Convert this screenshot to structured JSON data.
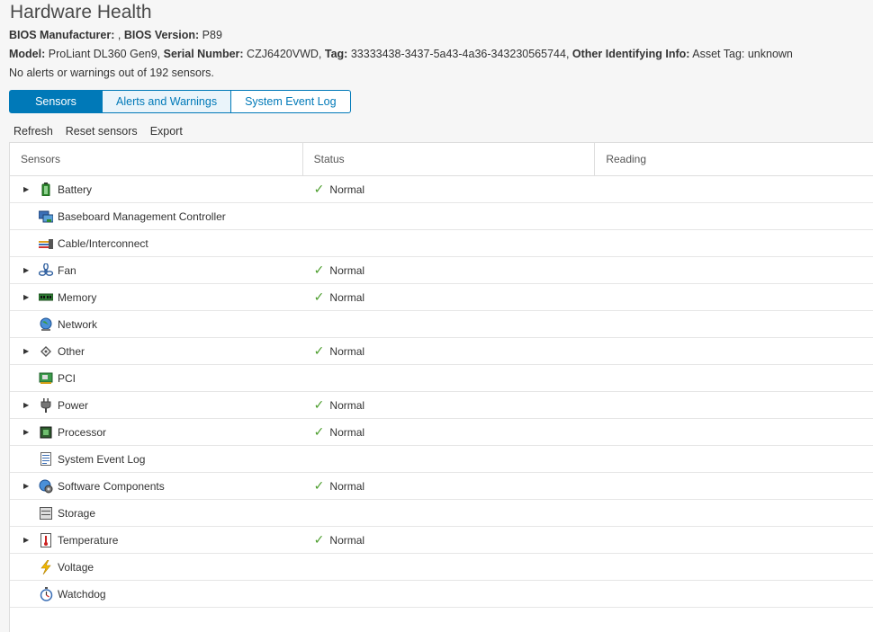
{
  "page": {
    "title": "Hardware Health",
    "bios_manufacturer_label": "BIOS Manufacturer:",
    "bios_manufacturer_value": " ,",
    "bios_version_label": "BIOS Version:",
    "bios_version_value": " P89",
    "model_label": "Model:",
    "model_value": " ProLiant DL360 Gen9,",
    "serial_label": "Serial Number:",
    "serial_value": " CZJ6420VWD,",
    "tag_label": "Tag:",
    "tag_value": " 33333438-3437-5a43-4a36-343230565744,",
    "other_label": "Other Identifying Info:",
    "other_value": " Asset Tag: unknown",
    "summary": "No alerts or warnings out of 192 sensors."
  },
  "tabs": [
    "Sensors",
    "Alerts and Warnings",
    "System Event Log"
  ],
  "actions": [
    "Refresh",
    "Reset sensors",
    "Export"
  ],
  "columns": [
    "Sensors",
    "Status",
    "Reading"
  ],
  "rows": [
    {
      "name": "Battery",
      "status": "Normal",
      "reading": ""
    },
    {
      "name": "Baseboard Management Controller",
      "status": "",
      "reading": ""
    },
    {
      "name": "Cable/Interconnect",
      "status": "",
      "reading": ""
    },
    {
      "name": "Fan",
      "status": "Normal",
      "reading": ""
    },
    {
      "name": "Memory",
      "status": "Normal",
      "reading": ""
    },
    {
      "name": "Network",
      "status": "",
      "reading": ""
    },
    {
      "name": "Other",
      "status": "Normal",
      "reading": ""
    },
    {
      "name": "PCI",
      "status": "",
      "reading": ""
    },
    {
      "name": "Power",
      "status": "Normal",
      "reading": ""
    },
    {
      "name": "Processor",
      "status": "Normal",
      "reading": ""
    },
    {
      "name": "System Event Log",
      "status": "",
      "reading": ""
    },
    {
      "name": "Software Components",
      "status": "Normal",
      "reading": ""
    },
    {
      "name": "Storage",
      "status": "",
      "reading": ""
    },
    {
      "name": "Temperature",
      "status": "Normal",
      "reading": ""
    },
    {
      "name": "Voltage",
      "status": "",
      "reading": ""
    },
    {
      "name": "Watchdog",
      "status": "",
      "reading": ""
    }
  ],
  "colors": {
    "accent": "#0079b8",
    "ok": "#4b9d2c"
  }
}
